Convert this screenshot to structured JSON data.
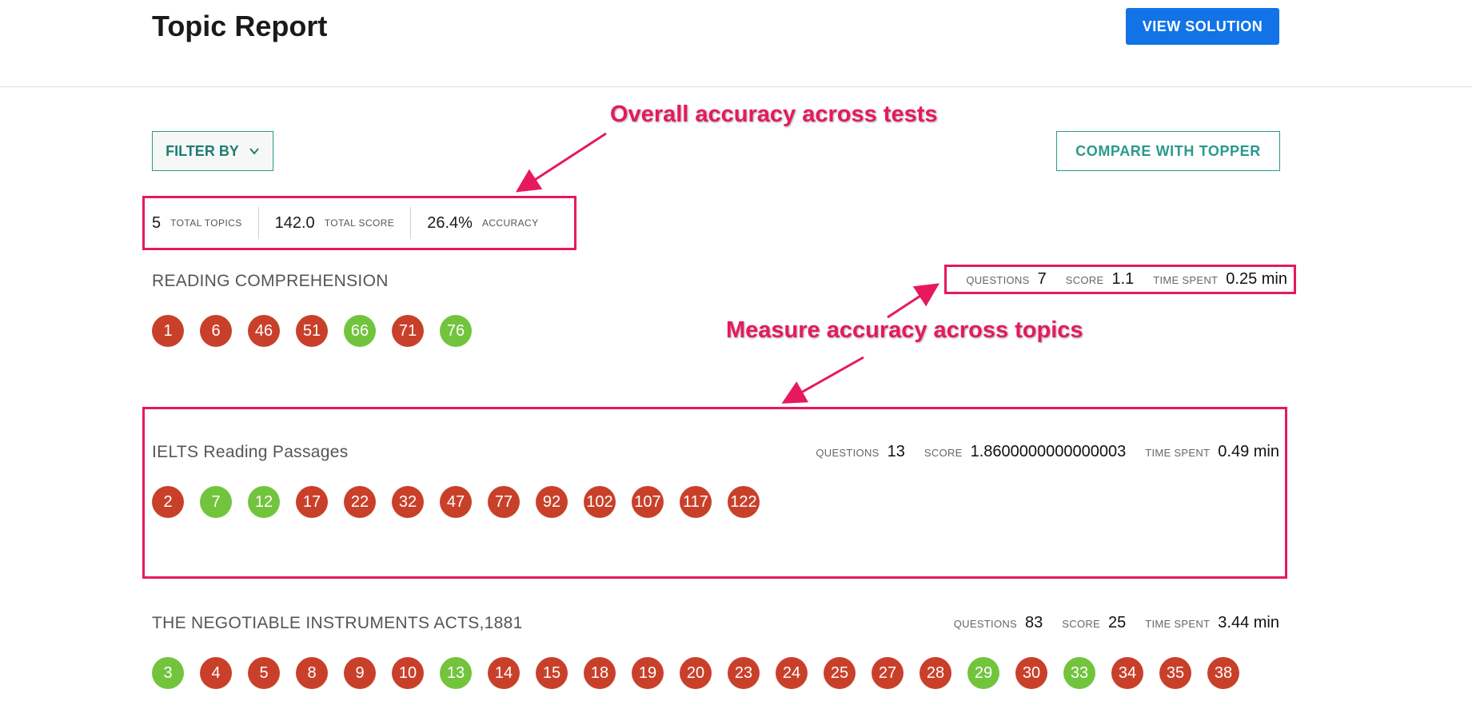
{
  "header": {
    "title": "Topic Report",
    "view_solution_label": "VIEW SOLUTION"
  },
  "toolbar": {
    "filter_label": "FILTER BY",
    "compare_label": "COMPARE WITH TOPPER"
  },
  "summary": {
    "total_topics_value": "5",
    "total_topics_label": "TOTAL TOPICS",
    "total_score_value": "142.0",
    "total_score_label": "TOTAL SCORE",
    "accuracy_value": "26.4%",
    "accuracy_label": "ACCURACY"
  },
  "meta_labels": {
    "questions": "QUESTIONS",
    "score": "SCORE",
    "time_spent": "TIME SPENT"
  },
  "topics": [
    {
      "name": "READING COMPREHENSION",
      "questions": "7",
      "score": "1.1",
      "time_spent": "0.25 min",
      "items": [
        {
          "n": "1",
          "s": "red"
        },
        {
          "n": "6",
          "s": "red"
        },
        {
          "n": "46",
          "s": "red"
        },
        {
          "n": "51",
          "s": "red"
        },
        {
          "n": "66",
          "s": "green"
        },
        {
          "n": "71",
          "s": "red"
        },
        {
          "n": "76",
          "s": "green"
        }
      ]
    },
    {
      "name": "IELTS Reading Passages",
      "questions": "13",
      "score": "1.8600000000000003",
      "time_spent": "0.49 min",
      "items": [
        {
          "n": "2",
          "s": "red"
        },
        {
          "n": "7",
          "s": "green"
        },
        {
          "n": "12",
          "s": "green"
        },
        {
          "n": "17",
          "s": "red"
        },
        {
          "n": "22",
          "s": "red"
        },
        {
          "n": "32",
          "s": "red"
        },
        {
          "n": "47",
          "s": "red"
        },
        {
          "n": "77",
          "s": "red"
        },
        {
          "n": "92",
          "s": "red"
        },
        {
          "n": "102",
          "s": "red"
        },
        {
          "n": "107",
          "s": "red"
        },
        {
          "n": "117",
          "s": "red"
        },
        {
          "n": "122",
          "s": "red"
        }
      ]
    },
    {
      "name": "THE NEGOTIABLE INSTRUMENTS ACTS,1881",
      "questions": "83",
      "score": "25",
      "time_spent": "3.44 min",
      "items": [
        {
          "n": "3",
          "s": "green"
        },
        {
          "n": "4",
          "s": "red"
        },
        {
          "n": "5",
          "s": "red"
        },
        {
          "n": "8",
          "s": "red"
        },
        {
          "n": "9",
          "s": "red"
        },
        {
          "n": "10",
          "s": "red"
        },
        {
          "n": "13",
          "s": "green"
        },
        {
          "n": "14",
          "s": "red"
        },
        {
          "n": "15",
          "s": "red"
        },
        {
          "n": "18",
          "s": "red"
        },
        {
          "n": "19",
          "s": "red"
        },
        {
          "n": "20",
          "s": "red"
        },
        {
          "n": "23",
          "s": "red"
        },
        {
          "n": "24",
          "s": "red"
        },
        {
          "n": "25",
          "s": "red"
        },
        {
          "n": "27",
          "s": "red"
        },
        {
          "n": "28",
          "s": "red"
        },
        {
          "n": "29",
          "s": "green"
        },
        {
          "n": "30",
          "s": "red"
        },
        {
          "n": "33",
          "s": "green"
        },
        {
          "n": "34",
          "s": "red"
        },
        {
          "n": "35",
          "s": "red"
        },
        {
          "n": "38",
          "s": "red"
        }
      ]
    }
  ],
  "annotations": {
    "overall": "Overall accuracy across tests",
    "topics": "Measure accuracy across topics"
  },
  "colors": {
    "correct": "#72c43d",
    "incorrect": "#c9402a",
    "annotation": "#e6195c",
    "primary": "#1173e6",
    "teal": "#2a9a8a"
  },
  "icons": {
    "filter_chevron": "chevron-down-icon"
  }
}
